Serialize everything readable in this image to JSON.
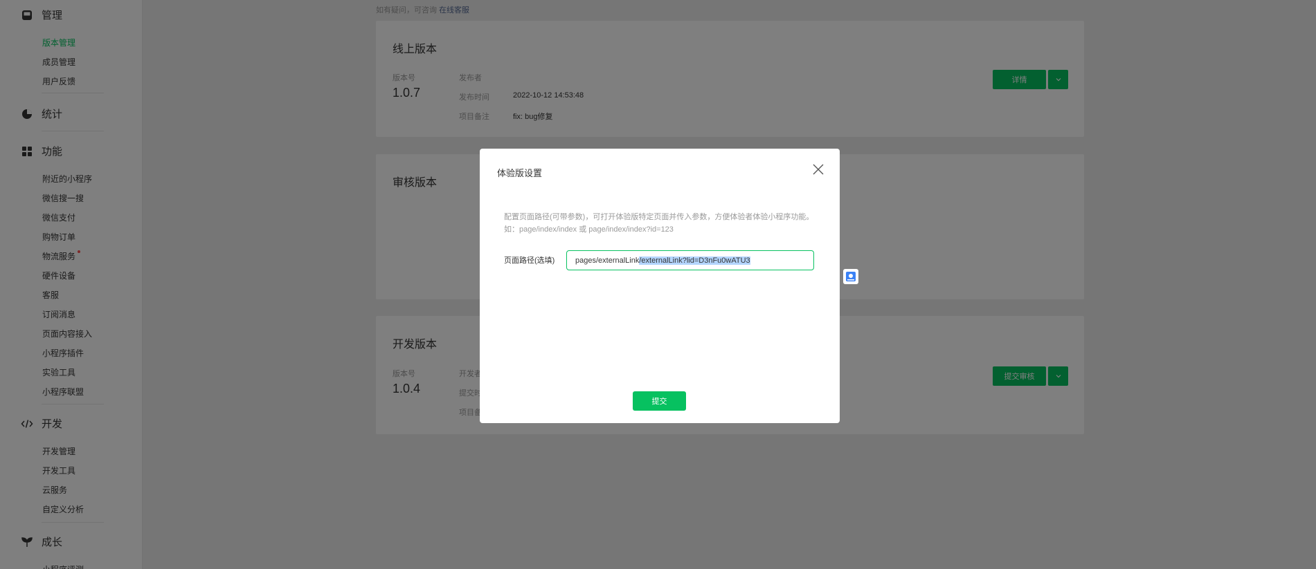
{
  "sidebar": {
    "management": {
      "title": "管理",
      "items": [
        "版本管理",
        "成员管理",
        "用户反馈"
      ]
    },
    "stats": {
      "title": "统计"
    },
    "features": {
      "title": "功能",
      "items": [
        "附近的小程序",
        "微信搜一搜",
        "微信支付",
        "购物订单",
        "物流服务",
        "硬件设备",
        "客服",
        "订阅消息",
        "页面内容接入",
        "小程序插件",
        "实验工具",
        "小程序联盟"
      ]
    },
    "dev": {
      "title": "开发",
      "items": [
        "开发管理",
        "开发工具",
        "云服务",
        "自定义分析"
      ]
    },
    "growth": {
      "title": "成长",
      "items": [
        "小程序评测"
      ]
    }
  },
  "main": {
    "tip_text": "如有疑问，可咨询",
    "tip_link": "在线客服",
    "online": {
      "title": "线上版本",
      "version_label": "版本号",
      "version": "1.0.7",
      "publisher_label": "发布者",
      "publisher": "",
      "time_label": "发布时间",
      "time": "2022-10-12 14:53:48",
      "note_label": "项目备注",
      "note": "fix: bug修复",
      "detail_button": "详情"
    },
    "review": {
      "title": "审核版本"
    },
    "develop": {
      "title": "开发版本",
      "version_label": "版本号",
      "version": "1.0.4",
      "dev_label": "开发者",
      "submit_label": "提交时",
      "note_label": "项目备",
      "submit_review_button": "提交审核"
    }
  },
  "dialog": {
    "title": "体验版设置",
    "description": "配置页面路径(可带参数)，可打开体验版特定页面并传入参数，方便体验者体验小程序功能。如：page/index/index 或 page/index/index?id=123",
    "path_label": "页面路径(选填)",
    "path_value_plain": "pages/externalLink",
    "path_value_selected": "/externalLink?lid=D3nFu0wATU3",
    "submit_button": "提交"
  },
  "colors": {
    "accent": "#07c160",
    "link": "#576b95",
    "alert": "#fa5151"
  }
}
